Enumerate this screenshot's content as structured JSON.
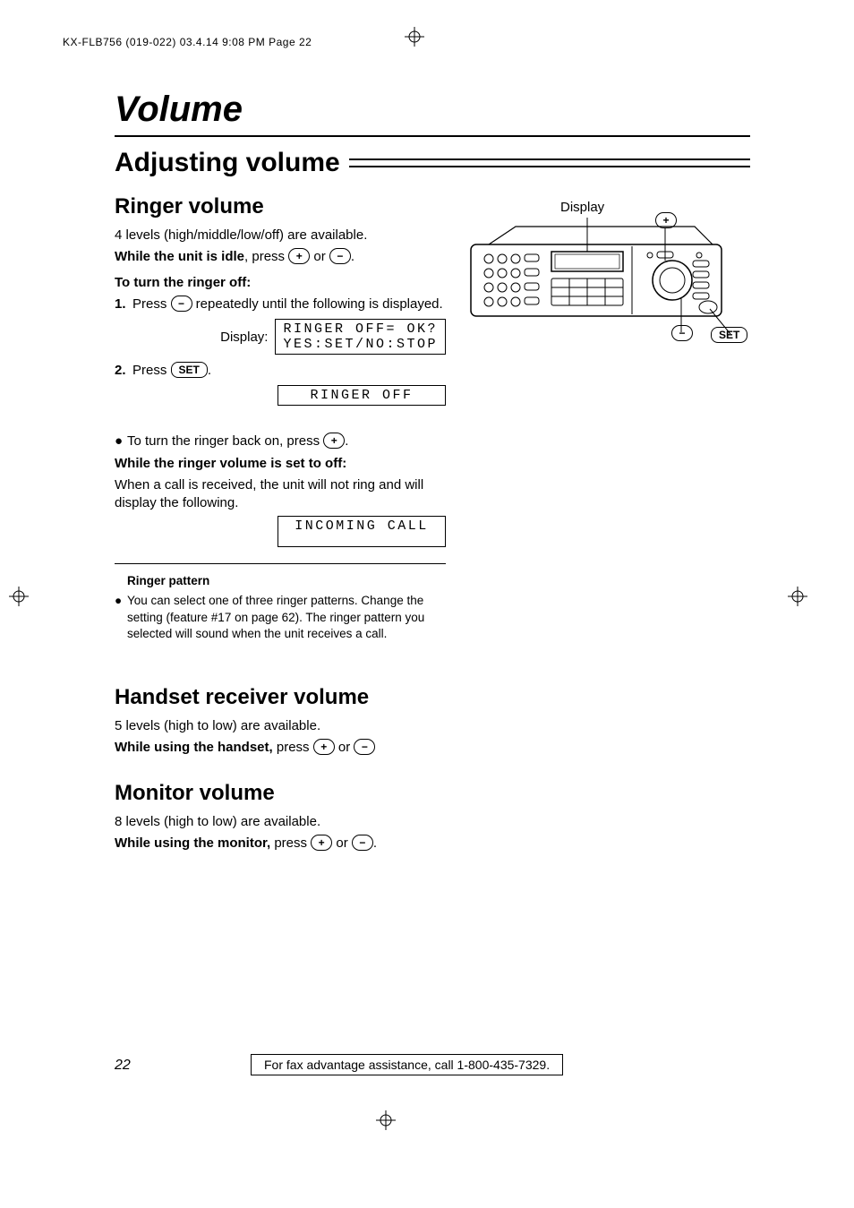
{
  "slug": "KX-FLB756 (019-022)  03.4.14  9:08 PM  Page 22",
  "title": "Volume",
  "h1": "Adjusting volume",
  "ringer": {
    "h2": "Ringer volume",
    "levels": "4 levels (high/middle/low/off) are available.",
    "idle_b": "While the unit is idle",
    "idle_rest": ", press ",
    "or": " or ",
    "turn_off_h": "To turn the ringer off:",
    "step1_pre": "Press ",
    "step1_post": " repeatedly until the following is displayed.",
    "display_label": "Display:",
    "lcd1a": "RINGER OFF= OK?",
    "lcd1b": "YES:SET/NO:STOP",
    "step2_pre": "Press ",
    "lcd2": "RINGER OFF",
    "back_on_pre": "To turn the ringer back on, press ",
    "off_h": "While the ringer volume is set to off:",
    "off_body": "When a call is received, the unit will not ring and will display the following.",
    "lcd3": "INCOMING CALL"
  },
  "pattern": {
    "h": "Ringer pattern",
    "body": "You can select one of three ringer patterns. Change the setting (feature #17 on page 62). The ringer pattern you selected will sound when the unit receives a call."
  },
  "handset": {
    "h2": "Handset receiver volume",
    "levels": "5 levels (high to low) are available.",
    "using_b": "While using the handset,",
    "press": " press "
  },
  "monitor": {
    "h2": "Monitor volume",
    "levels": "8 levels (high to low) are available.",
    "using_b": "While using the monitor,",
    "press": " press "
  },
  "keys": {
    "plus": "+",
    "minus": "−",
    "set": "SET"
  },
  "device": {
    "display": "Display",
    "set": "SET",
    "plus": "+",
    "minus": "−"
  },
  "page_number": "22",
  "footer": "For fax advantage assistance, call 1-800-435-7329."
}
